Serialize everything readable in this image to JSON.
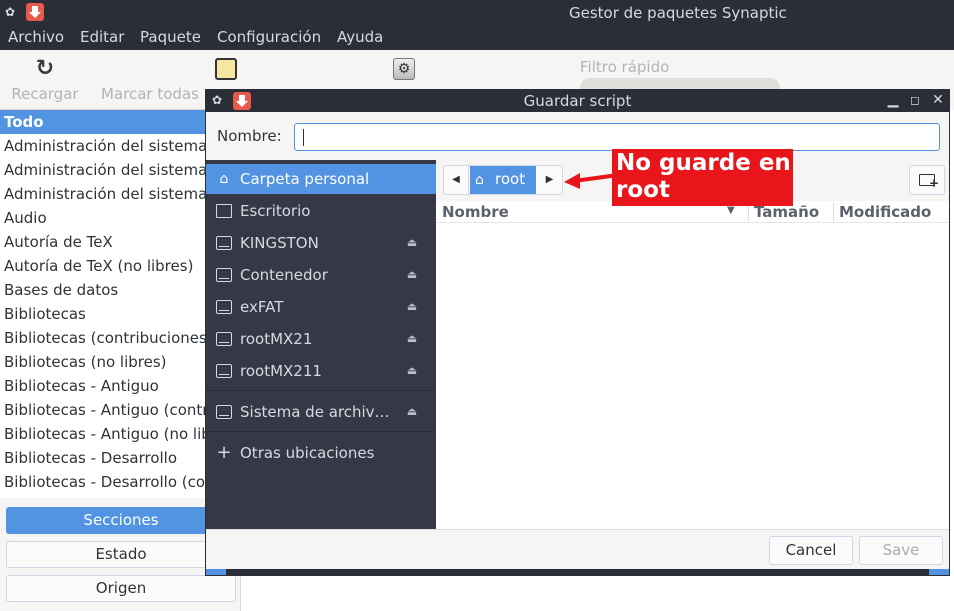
{
  "main_window": {
    "title": "Gestor de paquetes Synaptic",
    "menu": [
      "Archivo",
      "Editar",
      "Paquete",
      "Configuración",
      "Ayuda"
    ],
    "toolbar": {
      "reload_label": "Recargar",
      "mark_all_label": "Marcar todas",
      "quick_filter_label": "Filtro rápido"
    },
    "sections": [
      "Todo",
      "Administración del sistema",
      "Administración del sistema",
      "Administración del sistema",
      "Audio",
      "Autoría de TeX",
      "Autoría de TeX (no libres)",
      "Bases de datos",
      "Bibliotecas",
      "Bibliotecas (contribuciones)",
      "Bibliotecas (no libres)",
      "Bibliotecas - Antiguo",
      "Bibliotecas - Antiguo (contribuciones)",
      "Bibliotecas - Antiguo (no libres)",
      "Bibliotecas - Desarrollo",
      "Bibliotecas - Desarrollo (contribuciones)"
    ],
    "filter_buttons": {
      "sections": "Secciones",
      "status": "Estado",
      "origin": "Origen"
    }
  },
  "dialog": {
    "title": "Guardar script",
    "name_label": "Nombre:",
    "name_value": "",
    "places": {
      "home": "Carpeta personal",
      "desktop": "Escritorio",
      "kingston": "KINGSTON",
      "contenedor": "Contenedor",
      "exfat": "exFAT",
      "rootmx21": "rootMX21",
      "rootmx211": "rootMX211",
      "filesystem": "Sistema de archiv…",
      "other": "Otras ubicaciones"
    },
    "path_crumb": "root",
    "columns": {
      "name": "Nombre",
      "size": "Tamaño",
      "modified": "Modificado"
    },
    "buttons": {
      "cancel": "Cancel",
      "save": "Save"
    }
  },
  "annotation": {
    "line1": "No guarde en",
    "line2": "root",
    "color": "#e8151a"
  }
}
